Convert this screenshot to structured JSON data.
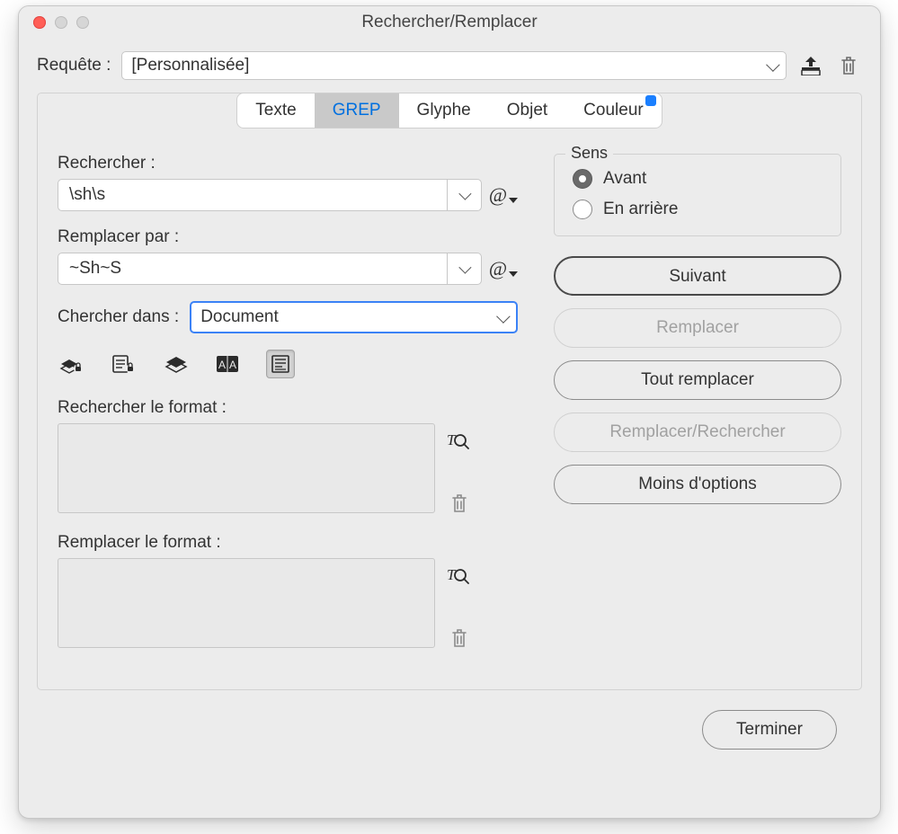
{
  "window": {
    "title": "Rechercher/Remplacer"
  },
  "query": {
    "label": "Requête :",
    "value": "[Personnalisée]"
  },
  "tabs": [
    {
      "label": "Texte",
      "active": false,
      "badge": false
    },
    {
      "label": "GREP",
      "active": true,
      "badge": false
    },
    {
      "label": "Glyphe",
      "active": false,
      "badge": false
    },
    {
      "label": "Objet",
      "active": false,
      "badge": false
    },
    {
      "label": "Couleur",
      "active": false,
      "badge": true
    }
  ],
  "find": {
    "label": "Rechercher :",
    "value": "\\sh\\s"
  },
  "replace": {
    "label": "Remplacer par :",
    "value": "~Sh~S"
  },
  "searchin": {
    "label": "Chercher dans :",
    "value": "Document"
  },
  "scope_icons": [
    {
      "name": "locked-layers-icon"
    },
    {
      "name": "locked-stories-icon"
    },
    {
      "name": "hidden-layers-icon"
    },
    {
      "name": "master-pages-icon"
    },
    {
      "name": "footnotes-icon",
      "selected": true
    }
  ],
  "find_format": {
    "label": "Rechercher le format :"
  },
  "replace_format": {
    "label": "Remplacer le format :"
  },
  "direction": {
    "legend": "Sens",
    "options": [
      {
        "label": "Avant",
        "checked": true
      },
      {
        "label": "En arrière",
        "checked": false
      }
    ]
  },
  "buttons": {
    "next": "Suivant",
    "replace": "Remplacer",
    "replace_all": "Tout remplacer",
    "replace_find": "Remplacer/Rechercher",
    "less_options": "Moins d'options",
    "done": "Terminer"
  }
}
